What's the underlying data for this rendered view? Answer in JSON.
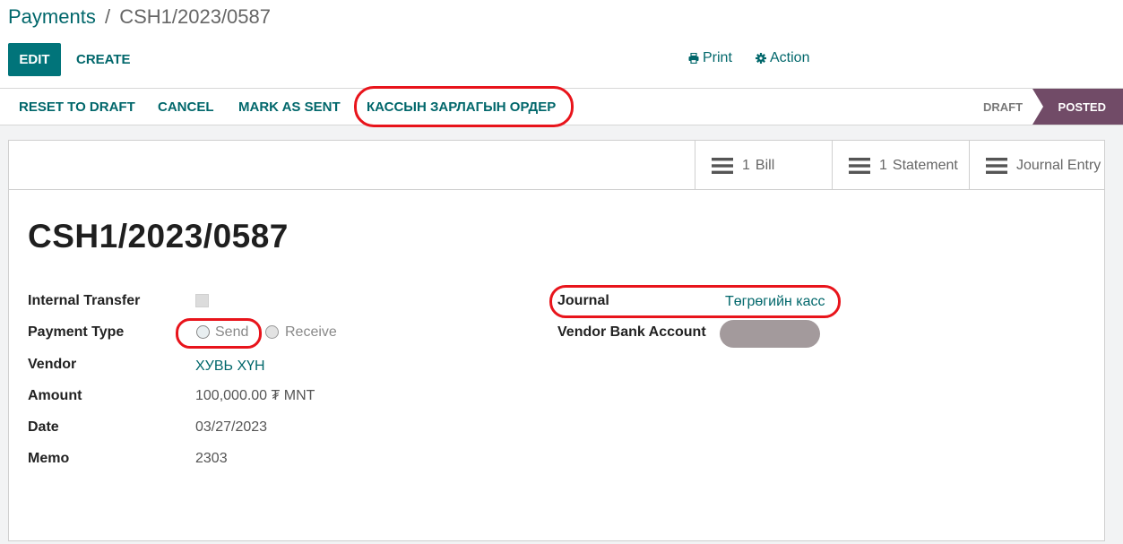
{
  "breadcrumb": {
    "parent": "Payments",
    "separator": "/",
    "current": "CSH1/2023/0587"
  },
  "toolbar": {
    "edit_label": "EDIT",
    "create_label": "CREATE",
    "print_label": "Print",
    "action_label": "Action"
  },
  "statusbar": {
    "buttons": [
      "RESET TO DRAFT",
      "CANCEL",
      "MARK AS SENT",
      "КАССЫН ЗАРЛАГЫН ОРДЕР"
    ],
    "stages": {
      "draft": "DRAFT",
      "posted": "POSTED",
      "active": "posted"
    }
  },
  "smart_buttons": [
    {
      "count": "1",
      "label": "Bill",
      "icon": "list-icon"
    },
    {
      "count": "1",
      "label": "Statement",
      "icon": "list-icon"
    },
    {
      "count": "",
      "label": "Journal Entry",
      "icon": "list-icon"
    }
  ],
  "record": {
    "title": "CSH1/2023/0587",
    "fields": {
      "internal_transfer": {
        "label": "Internal Transfer",
        "checked": false
      },
      "payment_type": {
        "label": "Payment Type",
        "options": [
          "Send",
          "Receive"
        ],
        "selected": "Send"
      },
      "vendor": {
        "label": "Vendor",
        "value": "ХУВЬ ХҮН"
      },
      "amount": {
        "label": "Amount",
        "value": "100,000.00 ₮ MNT"
      },
      "date": {
        "label": "Date",
        "value": "03/27/2023"
      },
      "memo": {
        "label": "Memo",
        "value": "2303"
      },
      "journal": {
        "label": "Journal",
        "value": "Төгрөгийн касс"
      },
      "vendor_bank_account": {
        "label": "Vendor Bank Account"
      }
    }
  },
  "colors": {
    "brand": "#01747a",
    "link": "#01676b",
    "posted_stage": "#714b67",
    "highlight": "#e8141b"
  }
}
